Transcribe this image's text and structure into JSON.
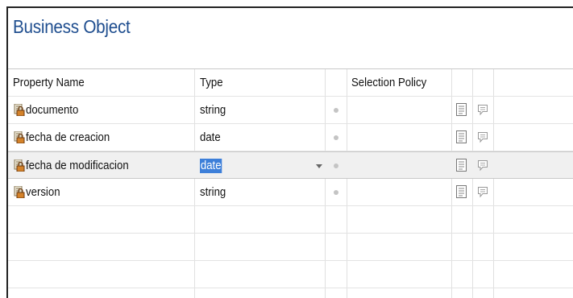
{
  "panel": {
    "title": "Business Object"
  },
  "columns": {
    "property_name": "Property Name",
    "type": "Type",
    "selection_policy": "Selection Policy"
  },
  "rows": [
    {
      "name": "documento",
      "type": "string",
      "selected": false
    },
    {
      "name": "fecha de creacion",
      "type": "date",
      "selected": false
    },
    {
      "name": "fecha de modificacion",
      "type": "date",
      "selected": true
    },
    {
      "name": "version",
      "type": "string",
      "selected": false
    }
  ],
  "icons": {
    "property": "property-lock-icon",
    "status": "status-dot-icon",
    "document": "document-icon",
    "comment": "comment-icon",
    "dropdown": "chevron-down-icon"
  },
  "colors": {
    "title": "#1f4e8f",
    "selection_highlight": "#3d7fd9",
    "row_selected_bg": "#f0f0f0"
  }
}
